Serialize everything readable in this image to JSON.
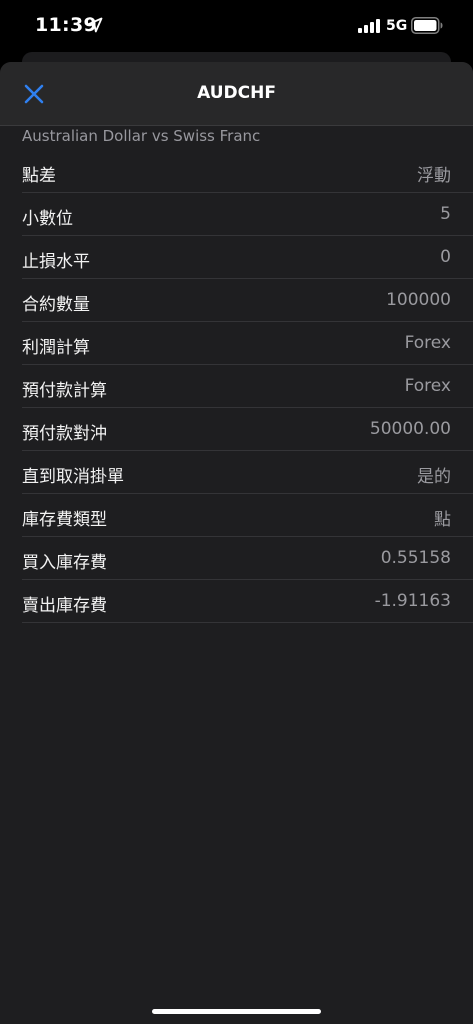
{
  "status_bar": {
    "time": "11:39",
    "network": "5G"
  },
  "header": {
    "title": "AUDCHF",
    "close_icon": "close-icon"
  },
  "subtitle": "Australian Dollar vs Swiss Franc",
  "colors": {
    "accent": "#2f80f0",
    "sheet_background": "#1e1e20",
    "nav_background": "#282829",
    "value_text": "#9a9a9f"
  },
  "rows": [
    {
      "label": "點差",
      "value": "浮動"
    },
    {
      "label": "小數位",
      "value": "5"
    },
    {
      "label": "止損水平",
      "value": "0"
    },
    {
      "label": "合約數量",
      "value": "100000"
    },
    {
      "label": "利潤計算",
      "value": "Forex"
    },
    {
      "label": "預付款計算",
      "value": "Forex"
    },
    {
      "label": "預付款對沖",
      "value": "50000.00"
    },
    {
      "label": "直到取消掛單",
      "value": "是的"
    },
    {
      "label": "庫存費類型",
      "value": "點"
    },
    {
      "label": "買入庫存費",
      "value": "0.55158"
    },
    {
      "label": "賣出庫存費",
      "value": "-1.91163"
    }
  ]
}
